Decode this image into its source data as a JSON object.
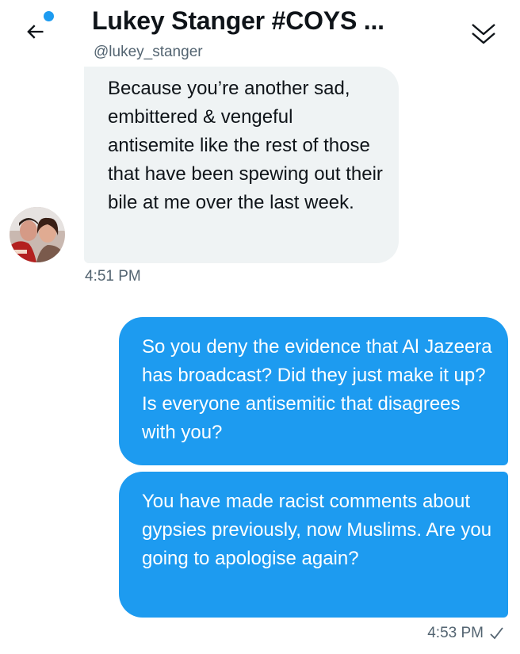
{
  "header": {
    "title": "Lukey Stanger #COYS ...",
    "handle": "@lukey_stanger",
    "has_unread": true,
    "accent_color": "#1d9bf0"
  },
  "messages": [
    {
      "direction": "received",
      "text": "Because you’re another sad, embittered & vengeful antisemite like the rest of those that have been spewing out their bile at me over the last week.",
      "time": "4:51 PM"
    },
    {
      "direction": "sent",
      "text": "So you deny the evidence that Al Jazeera has broadcast? Did they just make it up? Is everyone antisemitic that disagrees with you?"
    },
    {
      "direction": "sent",
      "text": "You have made racist comments about gypsies previously, now Muslims. Are you going to apologise again?",
      "time": "4:53 PM",
      "status": "sent-check"
    }
  ],
  "icons": {
    "back": "arrow-left-icon",
    "collapse": "chevrons-down-icon",
    "status": "checkmark-icon"
  },
  "colors": {
    "received_bubble": "#eff3f4",
    "sent_bubble": "#1d9bf0",
    "secondary_text": "#536471"
  }
}
